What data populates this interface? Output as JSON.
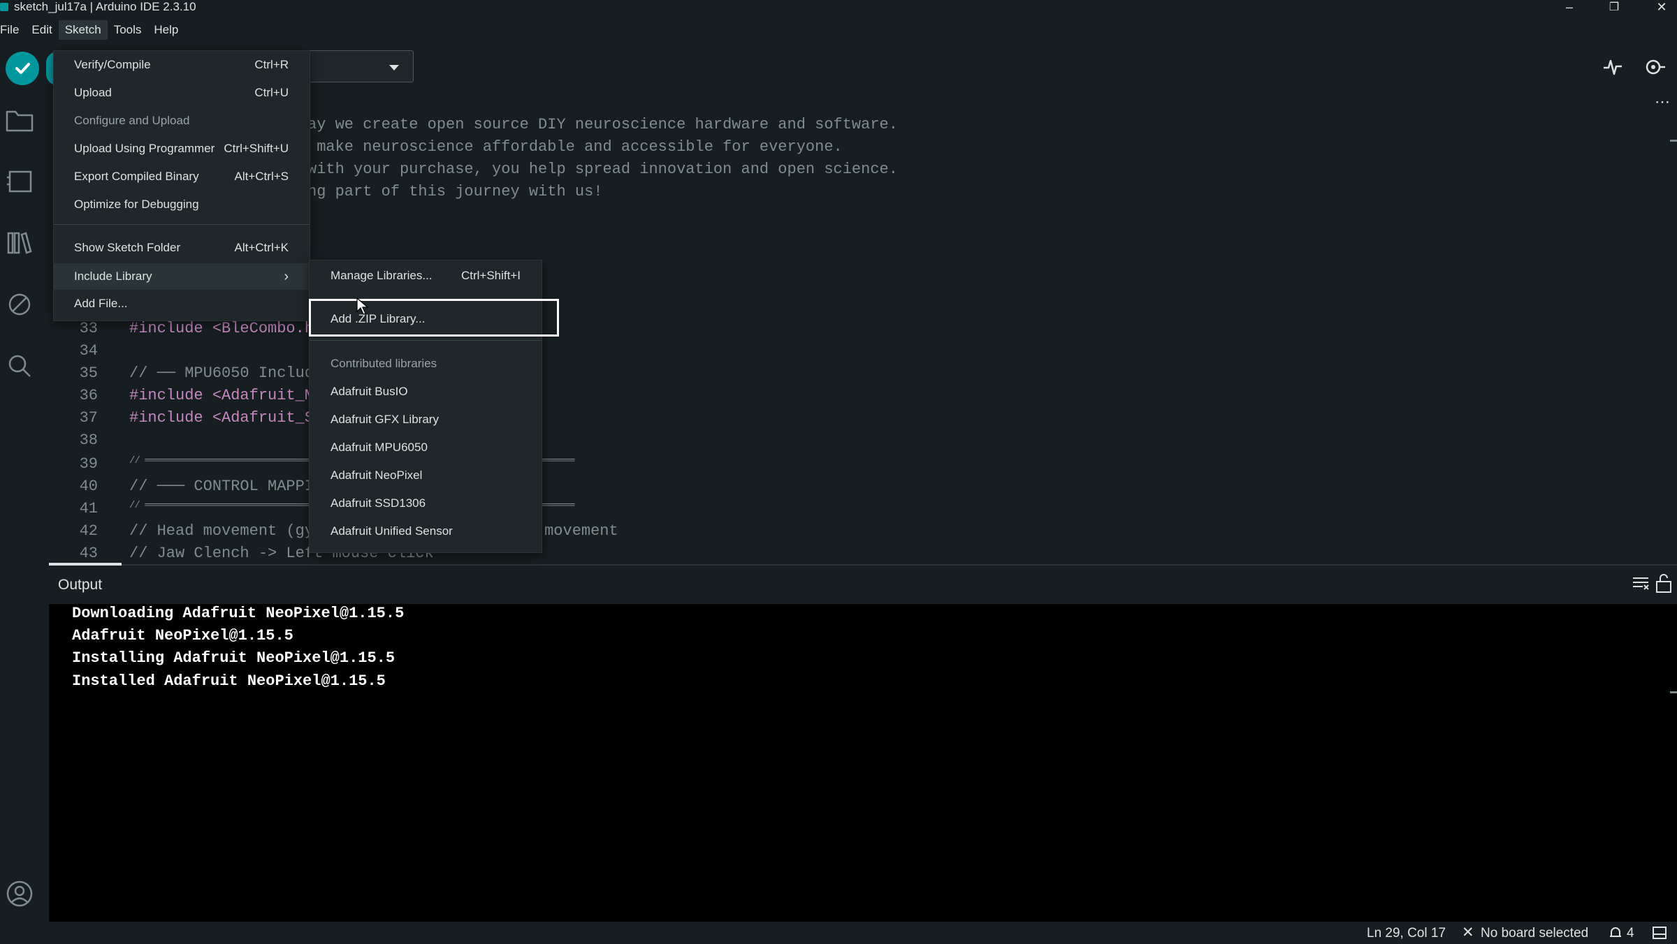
{
  "window": {
    "title": "sketch_jul17a | Arduino IDE 2.3.10",
    "minimize": "–",
    "restore": "❐",
    "close": "✕"
  },
  "menubar": [
    "File",
    "Edit",
    "Sketch",
    "Tools",
    "Help"
  ],
  "sketch_menu": {
    "items": [
      {
        "label": "Verify/Compile",
        "shortcut": "Ctrl+R"
      },
      {
        "label": "Upload",
        "shortcut": "Ctrl+U"
      },
      {
        "label": "Configure and Upload",
        "shortcut": ""
      },
      {
        "label": "Upload Using Programmer",
        "shortcut": "Ctrl+Shift+U"
      },
      {
        "label": "Export Compiled Binary",
        "shortcut": "Alt+Ctrl+S"
      },
      {
        "label": "Optimize for Debugging",
        "shortcut": ""
      },
      {
        "label": "Show Sketch Folder",
        "shortcut": "Alt+Ctrl+K"
      },
      {
        "label": "Include Library",
        "shortcut": "›"
      },
      {
        "label": "Add File...",
        "shortcut": ""
      }
    ]
  },
  "include_library_submenu": {
    "manage": {
      "label": "Manage Libraries...",
      "shortcut": "Ctrl+Shift+I"
    },
    "add_zip": "Add .ZIP Library...",
    "heading": "Contributed libraries",
    "libraries": [
      "Adafruit BusIO",
      "Adafruit GFX Library",
      "Adafruit MPU6050",
      "Adafruit NeoPixel",
      "Adafruit SSD1306",
      "Adafruit Unified Sensor"
    ]
  },
  "editor": {
    "top_lines": [
      "ay we create open source DIY neuroscience hardware and software.",
      " make neuroscience affordable and accessible for everyone.",
      "with your purchase, you help spread innovation and open science.",
      "ng part of this journey with us!"
    ],
    "lines": [
      {
        "n": "33",
        "text": "#include <BleCombo.h>"
      },
      {
        "n": "34",
        "text": ""
      },
      {
        "n": "35",
        "text": "// ── MPU6050 Includes"
      },
      {
        "n": "36",
        "text": "#include <Adafruit_MPU6050.h>"
      },
      {
        "n": "37",
        "text": "#include <Adafruit_Sensor.h>"
      },
      {
        "n": "38",
        "text": ""
      },
      {
        "n": "39",
        "text": "// ═══════════════════════════════════════════════════════════════════════════════════"
      },
      {
        "n": "40",
        "text": "// ─── CONTROL MAPPING"
      },
      {
        "n": "41",
        "text": "// ═══════════════════════════════════════════════════════════════════════════════════"
      },
      {
        "n": "42",
        "text": "// Head movement (gy                         movement"
      },
      {
        "n": "43",
        "text": "// Jaw Clench -> Left mouse click"
      }
    ]
  },
  "output": {
    "title": "Output",
    "lines": [
      "Downloading Adafruit NeoPixel@1.15.5",
      "Adafruit NeoPixel@1.15.5",
      "Installing Adafruit NeoPixel@1.15.5",
      "Installed Adafruit NeoPixel@1.15.5"
    ]
  },
  "statusbar": {
    "position": "Ln 29, Col 17",
    "board": "No board selected",
    "notifications": "4"
  },
  "colors": {
    "accent": "#00979d",
    "background": "#171e21",
    "menu_bg": "#1f272a"
  }
}
